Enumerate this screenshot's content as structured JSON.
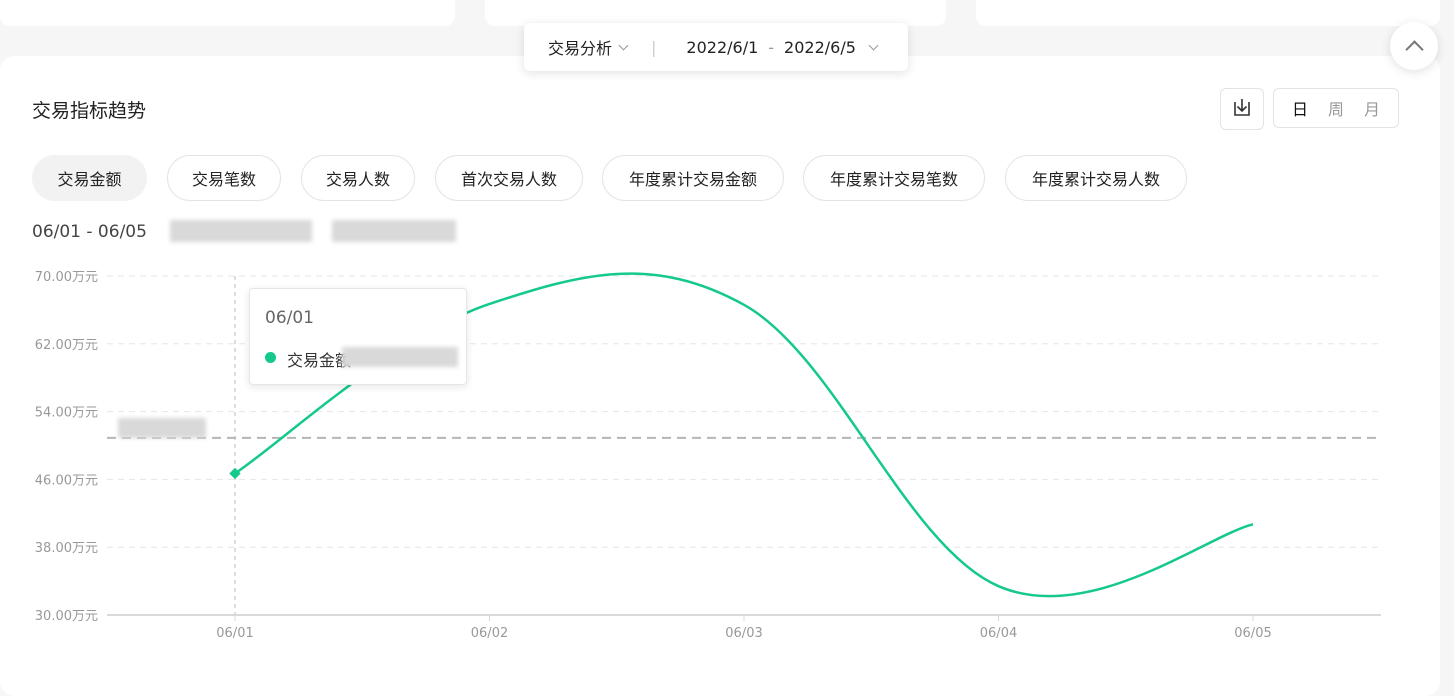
{
  "header": {
    "analysis_type": "交易分析",
    "date_start": "2022/6/1",
    "date_sep": "-",
    "date_end": "2022/6/5"
  },
  "section": {
    "title": "交易指标趋势",
    "period_options": [
      "日",
      "周",
      "月"
    ],
    "active_period": "日"
  },
  "metric_tabs": [
    "交易金额",
    "交易笔数",
    "交易人数",
    "首次交易人数",
    "年度累计交易金额",
    "年度累计交易笔数",
    "年度累计交易人数"
  ],
  "range_label": "06/01 - 06/05",
  "tooltip": {
    "date": "06/01",
    "series": "交易金额"
  },
  "colors": {
    "line": "#14c98b",
    "reference": "#b5b5b5",
    "grid": "#e6e6e6"
  },
  "chart_data": {
    "type": "line",
    "categories": [
      "06/01",
      "06/02",
      "06/03",
      "06/04",
      "06/05"
    ],
    "series": [
      {
        "name": "交易金额",
        "values": [
          46.7,
          66.7,
          66.6,
          33.4,
          40.7
        ]
      }
    ],
    "ylim": [
      30,
      70
    ],
    "yticks": [
      "30.00万元",
      "38.00万元",
      "46.00万元",
      "54.00万元",
      "62.00万元",
      "70.00万元"
    ],
    "reference_line": 50.9,
    "grid": true,
    "smooth": true
  }
}
